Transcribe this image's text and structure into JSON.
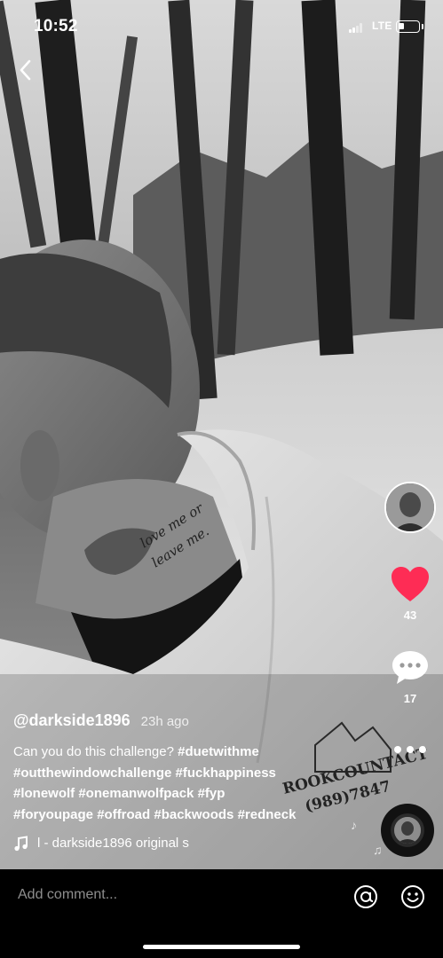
{
  "status_bar": {
    "time": "10:52",
    "network": "LTE",
    "battery_level": 0.3
  },
  "video": {
    "neck_tattoo_text": [
      "love me or",
      "leave me."
    ],
    "hoodie_print": [
      "ROOKCOUNTACT",
      "(989)7847"
    ]
  },
  "actions": {
    "like_count": "43",
    "like_color": "#fe2c55",
    "comment_count": "17"
  },
  "post": {
    "username": "@darkside1896",
    "timestamp": "23h ago",
    "description_lines": [
      [
        {
          "t": "Can you do this challenge? ",
          "tag": false
        },
        {
          "t": "#duetwithme",
          "tag": true
        }
      ],
      [
        {
          "t": "#outthewindowchallenge",
          "tag": true
        },
        {
          "t": " ",
          "tag": false
        },
        {
          "t": "#fuckhappiness",
          "tag": true
        }
      ],
      [
        {
          "t": "#lonewolf",
          "tag": true
        },
        {
          "t": " ",
          "tag": false
        },
        {
          "t": "#onemanwolfpack",
          "tag": true
        },
        {
          "t": " ",
          "tag": false
        },
        {
          "t": "#fyp",
          "tag": true
        }
      ],
      [
        {
          "t": "#foryoupage",
          "tag": true
        },
        {
          "t": " ",
          "tag": false
        },
        {
          "t": "#offroad",
          "tag": true
        },
        {
          "t": " ",
          "tag": false
        },
        {
          "t": "#backwoods",
          "tag": true
        },
        {
          "t": " ",
          "tag": false
        },
        {
          "t": "#redneck",
          "tag": true
        }
      ]
    ],
    "sound_text": "l - darkside1896      original s"
  },
  "bottom_bar": {
    "comment_placeholder": "Add comment..."
  },
  "icons": {
    "back": "chevron-left-icon",
    "like": "heart-icon",
    "comment": "speech-bubble-icon",
    "more": "ellipsis-icon",
    "music": "music-note-icon",
    "mention": "at-sign-icon",
    "emoji": "smiley-icon"
  }
}
